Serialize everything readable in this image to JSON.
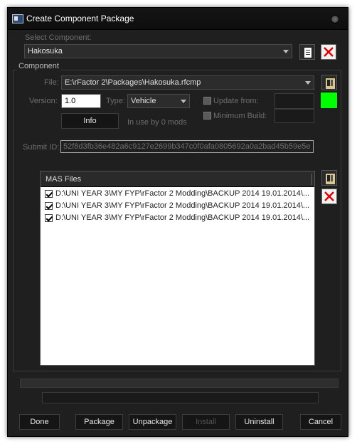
{
  "window": {
    "title": "Create Component Package"
  },
  "select_component": {
    "label": "Select Component:",
    "value": "Hakosuka"
  },
  "component_group": {
    "label": "Component"
  },
  "file": {
    "label": "File:",
    "value": "E:\\rFactor 2\\Packages\\Hakosuka.rfcmp"
  },
  "version": {
    "label": "Version:",
    "value": "1.0"
  },
  "type": {
    "label": "Type:",
    "value": "Vehicle"
  },
  "update_from": {
    "label": "Update from:",
    "checked": false
  },
  "minimum_build": {
    "label": "Minimum Build:",
    "checked": false
  },
  "status_color": "#00ff00",
  "info": {
    "button_label": "Info",
    "usage_text": "In use by 0 mods"
  },
  "submit_id": {
    "label": "Submit ID:",
    "value": "52f8d3fb36e482a6c9127e2699b347c0f0afa0805692a0a2bad45b59e5e"
  },
  "mas_files": {
    "header": "MAS Files",
    "rows": [
      {
        "checked": true,
        "path": "D:\\UNI YEAR 3\\MY FYP\\rFactor 2 Modding\\BACKUP 2014 19.01.2014\\..."
      },
      {
        "checked": true,
        "path": "D:\\UNI YEAR 3\\MY FYP\\rFactor 2 Modding\\BACKUP 2014 19.01.2014\\..."
      },
      {
        "checked": true,
        "path": "D:\\UNI YEAR 3\\MY FYP\\rFactor 2 Modding\\BACKUP 2014 19.01.2014\\..."
      }
    ]
  },
  "buttons": {
    "done": "Done",
    "package": "Package",
    "unpackage": "Unpackage",
    "install": "Install",
    "uninstall": "Uninstall",
    "cancel": "Cancel"
  },
  "icons": {
    "app": "app-window-icon",
    "close": "close-circle-icon",
    "new_doc": "document-icon",
    "delete": "red-x-icon",
    "package": "package-icon"
  }
}
